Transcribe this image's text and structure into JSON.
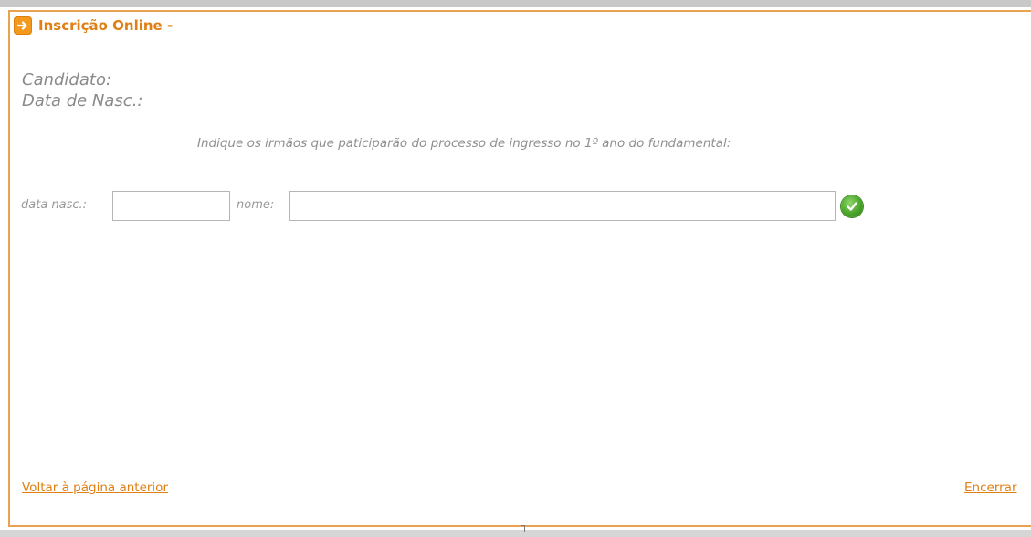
{
  "header": {
    "title": "Inscrição Online -",
    "icon": "arrow-right-icon",
    "accent_color": "#e07f13"
  },
  "candidate": {
    "name_label": "Candidato:",
    "birth_label": "Data de Nasc.:"
  },
  "instruction": "Indique os irmãos que paticiparão do processo de ingresso no 1º ano do fundamental:",
  "form": {
    "birth_label": "data nasc.:",
    "birth_value": "",
    "name_label": "nome:",
    "name_value": "",
    "confirm_icon": "check-circle-icon"
  },
  "footer": {
    "back_link": "Voltar à página anterior",
    "end_link": "Encerrar"
  },
  "colors": {
    "border": "#e8a250",
    "link": "#e07f13",
    "confirm": "#4aa52a"
  }
}
